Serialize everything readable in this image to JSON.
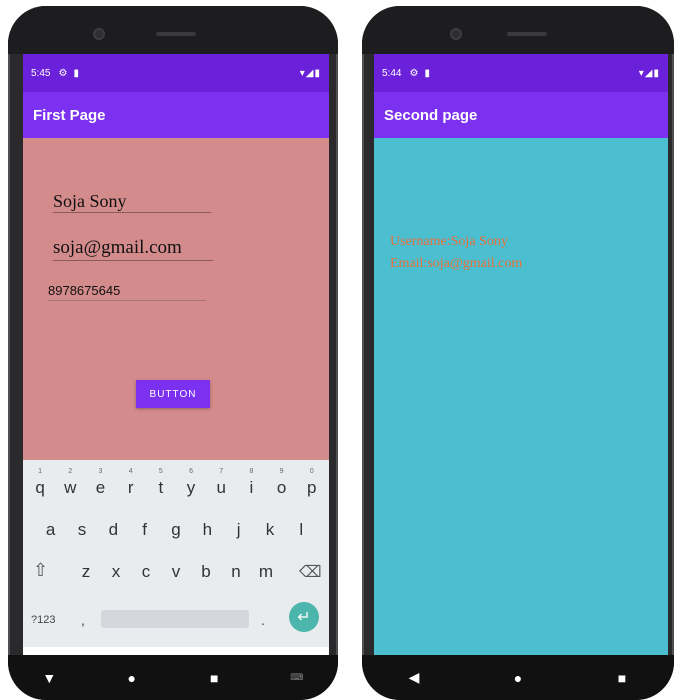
{
  "left_phone": {
    "status": {
      "time": "5:45",
      "icons": [
        "settings-icon",
        "sd-card-icon"
      ],
      "right_icons": "▾◢▮"
    },
    "appbar_title": "First Page",
    "fields": {
      "name": "Soja Sony",
      "email": "soja@gmail.com",
      "phone": "8978675645"
    },
    "button_label": "BUTTON",
    "keyboard": {
      "row1": [
        {
          "k": "q",
          "n": "1"
        },
        {
          "k": "w",
          "n": "2"
        },
        {
          "k": "e",
          "n": "3"
        },
        {
          "k": "r",
          "n": "4"
        },
        {
          "k": "t",
          "n": "5"
        },
        {
          "k": "y",
          "n": "6"
        },
        {
          "k": "u",
          "n": "7"
        },
        {
          "k": "i",
          "n": "8"
        },
        {
          "k": "o",
          "n": "9"
        },
        {
          "k": "p",
          "n": "0"
        }
      ],
      "row2": [
        "a",
        "s",
        "d",
        "f",
        "g",
        "h",
        "j",
        "k",
        "l"
      ],
      "row3": [
        "z",
        "x",
        "c",
        "v",
        "b",
        "n",
        "m"
      ],
      "sym_label": "?123",
      "comma": ",",
      "dot": "."
    }
  },
  "right_phone": {
    "status": {
      "time": "5:44",
      "icons": [
        "settings-icon",
        "sd-card-icon"
      ],
      "right_icons": "▾◢▮"
    },
    "appbar_title": "Second page",
    "username_line": "Username:Soja Sony",
    "email_line": "Email:soja@gmail.com"
  },
  "nav_icons": [
    "back-icon",
    "home-icon",
    "recents-icon"
  ],
  "colors": {
    "status_bar": "#6a21d9",
    "app_bar": "#7c31f0",
    "first_page_bg": "#d48b8b",
    "second_page_bg": "#4bbfd0",
    "info_text": "#e8703a",
    "enter_key": "#4db6ac"
  }
}
